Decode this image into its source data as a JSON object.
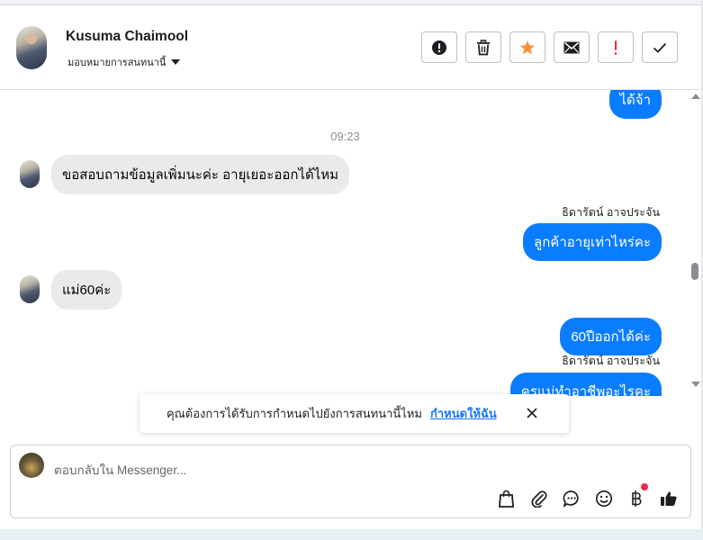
{
  "contact": {
    "name": "Kusuma Chaimool",
    "assign_label": "มอบหมายการสนทนานี้"
  },
  "header_actions": [
    {
      "icon": "alert-circle-icon"
    },
    {
      "icon": "trash-icon"
    },
    {
      "icon": "star-icon",
      "color": "#f7923b"
    },
    {
      "icon": "envelope-icon"
    },
    {
      "icon": "exclamation-icon",
      "color": "#f02849"
    },
    {
      "icon": "check-icon"
    }
  ],
  "messages": {
    "out_top": "ได้จ้า",
    "timestamp": "09:23",
    "in_1": "ขอสอบถามข้อมูลเพิ่มนะค่ะ อายุเยอะออกได้ไหม",
    "sender_1": "ธิดารัตน์ อาจประจัน",
    "out_1": "ลูกค้าอายุเท่าไหร่คะ",
    "in_2": "แม่60ค่ะ",
    "out_2": "60ปีออกได้ค่ะ",
    "sender_2": "ธิดารัตน์ อาจประจัน",
    "out_3": "ครแม่ทำอาชีพอะไรคะ"
  },
  "toast": {
    "text": "คุณต้องการได้รับการกำหนดไปยังการสนทนานี้ไหม",
    "link": "กำหนดให้ฉัน"
  },
  "composer": {
    "placeholder": "ตอบกลับใน Messenger..."
  },
  "composer_tools": [
    "shopping-bag-icon",
    "paperclip-icon",
    "chat-bubble-icon",
    "smiley-icon",
    "baht-icon",
    "thumbs-up-icon"
  ],
  "colors": {
    "accent": "#0a7cff",
    "star": "#f7923b",
    "alert": "#f02849",
    "link": "#1877f2"
  }
}
